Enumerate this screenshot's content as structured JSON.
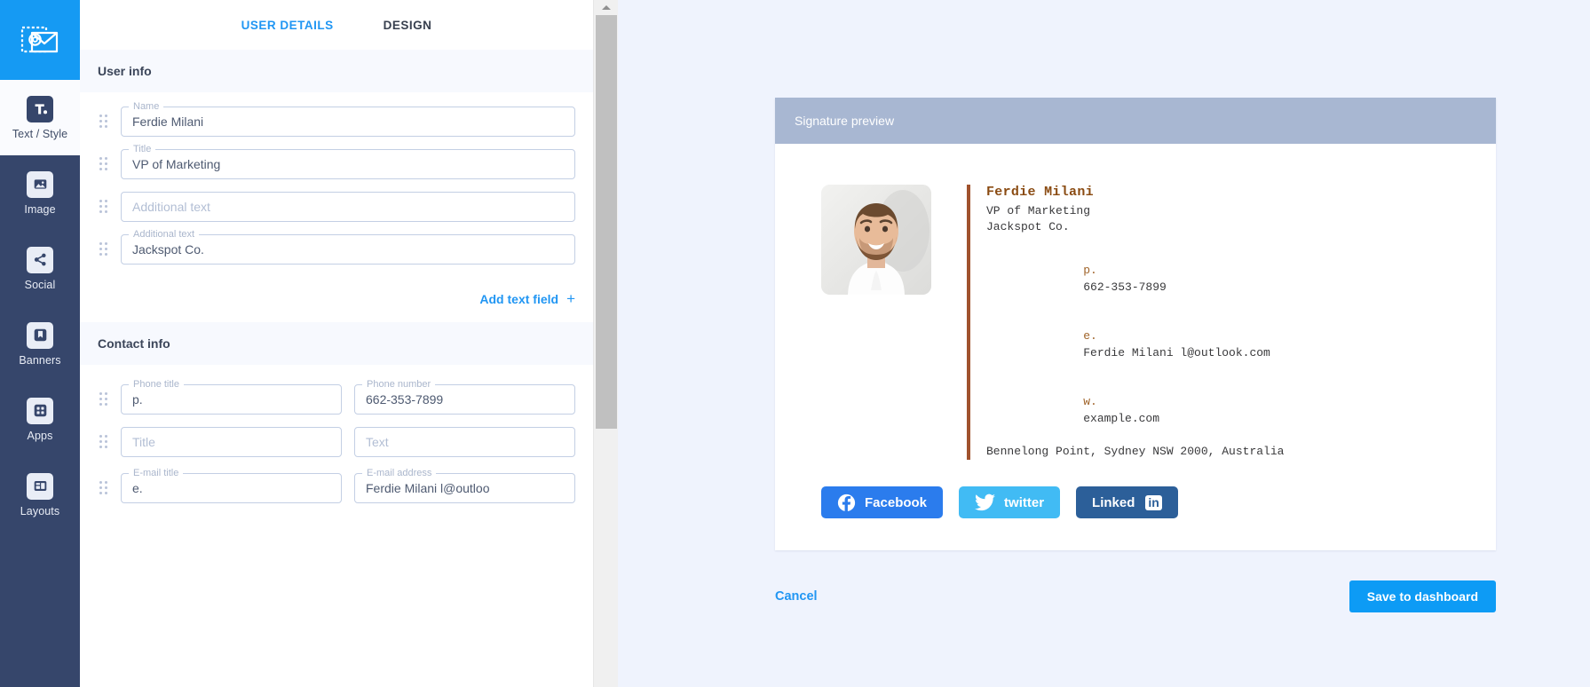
{
  "app": {
    "logo_icon": "envelope-at-stamp-icon"
  },
  "rail": {
    "items": [
      {
        "label": "Text / Style",
        "icon": "text-style-icon",
        "active": true
      },
      {
        "label": "Image",
        "icon": "image-icon",
        "active": false
      },
      {
        "label": "Social",
        "icon": "share-social-icon",
        "active": false
      },
      {
        "label": "Banners",
        "icon": "bookmark-banner-icon",
        "active": false
      },
      {
        "label": "Apps",
        "icon": "grid-apps-icon",
        "active": false
      },
      {
        "label": "Layouts",
        "icon": "layouts-icon",
        "active": false
      }
    ]
  },
  "tabs": [
    {
      "label": "USER DETAILS",
      "active": true
    },
    {
      "label": "DESIGN",
      "active": false
    }
  ],
  "user_info": {
    "heading": "User info",
    "fields": [
      {
        "label": "Name",
        "value": "Ferdie Milani",
        "placeholder": "Name"
      },
      {
        "label": "Title",
        "value": "VP of Marketing",
        "placeholder": "Title"
      },
      {
        "label": "",
        "value": "",
        "placeholder": "Additional text"
      },
      {
        "label": "Additional text",
        "value": "Jackspot Co.",
        "placeholder": "Additional text"
      }
    ],
    "add_text_field": "Add text field",
    "add_icon": "plus-icon"
  },
  "contact_info": {
    "heading": "Contact info",
    "rows": [
      {
        "title": {
          "label": "Phone title",
          "value": "p.",
          "placeholder": "Phone title"
        },
        "text": {
          "label": "Phone number",
          "value": "662-353-7899",
          "placeholder": "Phone number"
        }
      },
      {
        "title": {
          "label": "",
          "value": "",
          "placeholder": "Title"
        },
        "text": {
          "label": "",
          "value": "",
          "placeholder": "Text"
        }
      },
      {
        "title": {
          "label": "E-mail title",
          "value": "e.",
          "placeholder": "E-mail title"
        },
        "text": {
          "label": "E-mail address",
          "value": "Ferdie Milani l@outloo",
          "placeholder": "E-mail address"
        }
      }
    ]
  },
  "preview": {
    "header": "Signature preview",
    "signature": {
      "photo_icon": "profile-photo",
      "name": "Ferdie Milani",
      "title": "VP of Marketing",
      "company": "Jackspot Co.",
      "phone_prefix": "p.",
      "phone": "662-353-7899",
      "email_prefix": "e.",
      "email": "Ferdie Milani l@outlook.com",
      "web_prefix": "w.",
      "web": "example.com",
      "address": "Bennelong Point, Sydney NSW 2000, Australia"
    },
    "socials": [
      {
        "label": "Facebook",
        "icon": "facebook-icon",
        "color": "#2b7ced"
      },
      {
        "label": "twitter",
        "icon": "twitter-bird-icon",
        "color": "#41bbf4"
      },
      {
        "label": "Linked",
        "badge": "in",
        "icon": "linkedin-icon",
        "color": "#2c5f99"
      }
    ]
  },
  "footer": {
    "cancel": "Cancel",
    "save": "Save to dashboard"
  },
  "colors": {
    "accent_blue": "#2196f3",
    "save_blue": "#0d9bf5",
    "rail_dark": "#36466b",
    "logo_blue": "#159af3",
    "preview_bg": "#eff3fd",
    "card_head": "#a8b7d2",
    "sig_accent": "#a0522d"
  }
}
